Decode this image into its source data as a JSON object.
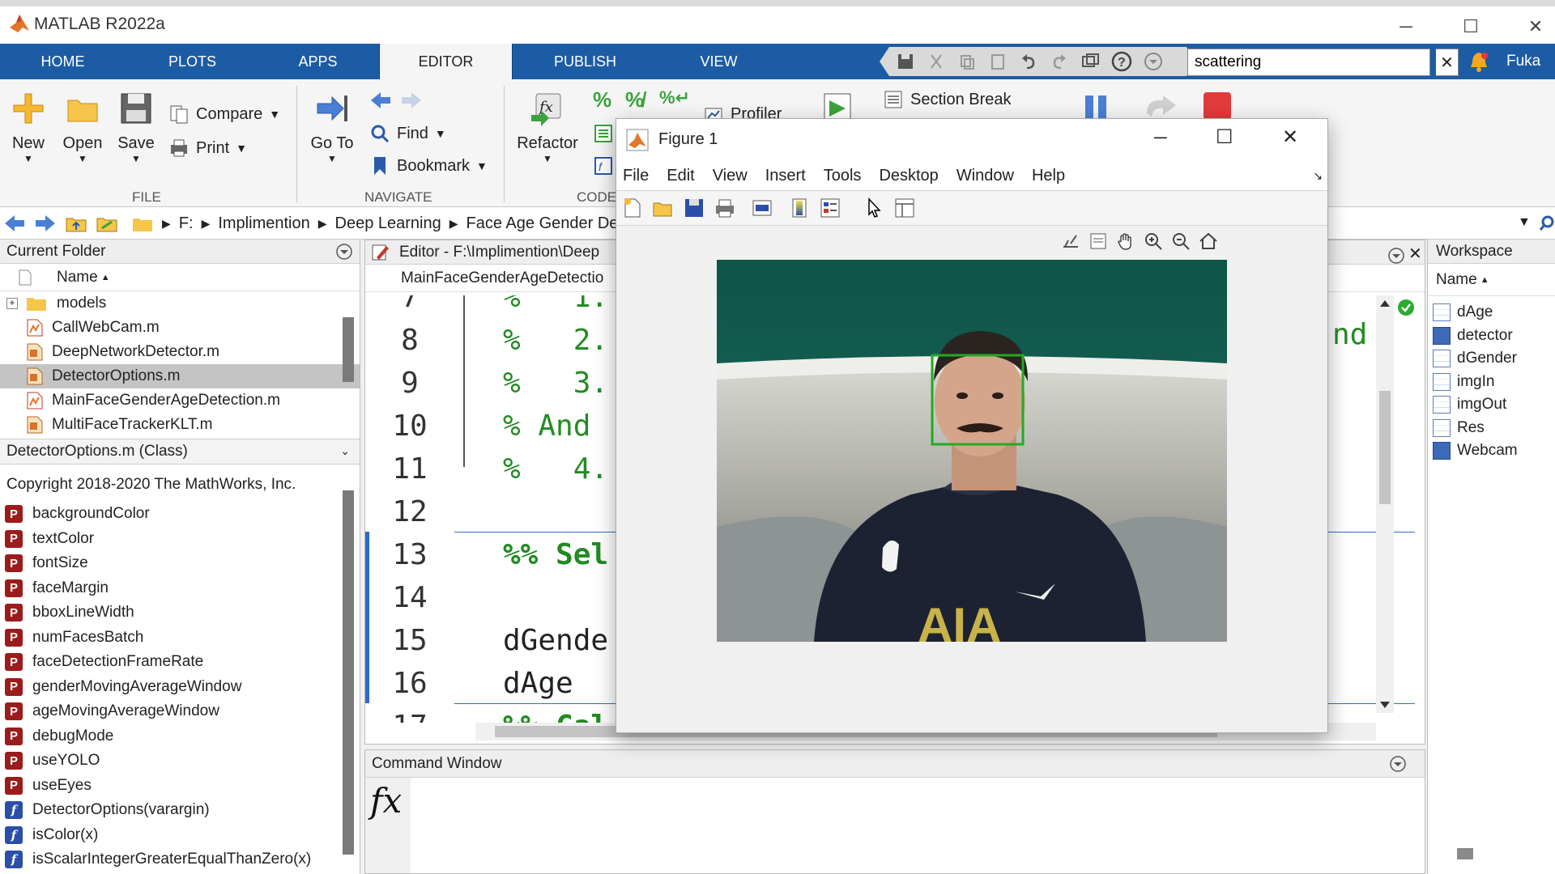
{
  "app": {
    "title": "MATLAB R2022a",
    "user": "Fuka",
    "search_value": "scattering"
  },
  "tabs": [
    "HOME",
    "PLOTS",
    "APPS",
    "EDITOR",
    "PUBLISH",
    "VIEW"
  ],
  "active_tab": "EDITOR",
  "ribbon": {
    "file": {
      "new": "New",
      "open": "Open",
      "save": "Save",
      "compare": "Compare",
      "print": "Print",
      "group": "FILE"
    },
    "navigate": {
      "goto": "Go To",
      "find": "Find",
      "bookmark": "Bookmark",
      "group": "NAVIGATE"
    },
    "code": {
      "refactor": "Refactor",
      "group": "CODE",
      "profiler": "Profiler",
      "section_break": "Section Break"
    }
  },
  "address": {
    "crumbs": [
      "F:",
      "Implimention",
      "Deep Learning",
      "Face Age Gender De"
    ]
  },
  "current_folder": {
    "title": "Current Folder",
    "column": "Name",
    "items": [
      {
        "name": "models",
        "type": "folder"
      },
      {
        "name": "CallWebCam.m",
        "type": "m"
      },
      {
        "name": "DeepNetworkDetector.m",
        "type": "m"
      },
      {
        "name": "DetectorOptions.m",
        "type": "m",
        "selected": true
      },
      {
        "name": "MainFaceGenderAgeDetection.m",
        "type": "m"
      },
      {
        "name": "MultiFaceTrackerKLT.m",
        "type": "m"
      }
    ]
  },
  "details": {
    "header": "DetectorOptions.m  (Class)",
    "copyright": "Copyright 2018-2020 The MathWorks, Inc.",
    "properties": [
      "backgroundColor",
      "textColor",
      "fontSize",
      "faceMargin",
      "bboxLineWidth",
      "numFacesBatch",
      "faceDetectionFrameRate",
      "genderMovingAverageWindow",
      "ageMovingAverageWindow",
      "debugMode",
      "useYOLO",
      "useEyes"
    ],
    "methods": [
      "DetectorOptions(varargin)",
      "isColor(x)",
      "isScalarIntegerGreaterEqualThanZero(x)"
    ]
  },
  "editor": {
    "title": "Editor - F:\\Implimention\\Deep",
    "file_tab": "MainFaceGenderAgeDetectio",
    "right_fragment": "nd",
    "lines": [
      {
        "n": "7",
        "text": "%   1."
      },
      {
        "n": "8",
        "text": "%   2."
      },
      {
        "n": "9",
        "text": "%   3."
      },
      {
        "n": "10",
        "text": "% And"
      },
      {
        "n": "11",
        "text": "%   4."
      },
      {
        "n": "12",
        "text": ""
      },
      {
        "n": "13",
        "text": "%% Sel"
      },
      {
        "n": "14",
        "text": ""
      },
      {
        "n": "15",
        "text": "dGende"
      },
      {
        "n": "16",
        "text": "dAge"
      },
      {
        "n": "17",
        "text": "%% Cal"
      }
    ]
  },
  "command_window": {
    "title": "Command Window",
    "prompt": "fx"
  },
  "workspace": {
    "title": "Workspace",
    "column": "Name",
    "vars": [
      {
        "name": "dAge",
        "kind": "matrix"
      },
      {
        "name": "detector",
        "kind": "object"
      },
      {
        "name": "dGender",
        "kind": "matrix"
      },
      {
        "name": "imgIn",
        "kind": "matrix"
      },
      {
        "name": "imgOut",
        "kind": "matrix"
      },
      {
        "name": "Res",
        "kind": "matrix"
      },
      {
        "name": "Webcam",
        "kind": "object"
      }
    ]
  },
  "figure": {
    "title": "Figure 1",
    "menu": [
      "File",
      "Edit",
      "View",
      "Insert",
      "Tools",
      "Desktop",
      "Window",
      "Help"
    ]
  },
  "colors": {
    "tabbar": "#1c5ca5",
    "face_box": "#22aa22",
    "comment": "#228b22",
    "cursor_highlight": "#5ee3f5"
  }
}
